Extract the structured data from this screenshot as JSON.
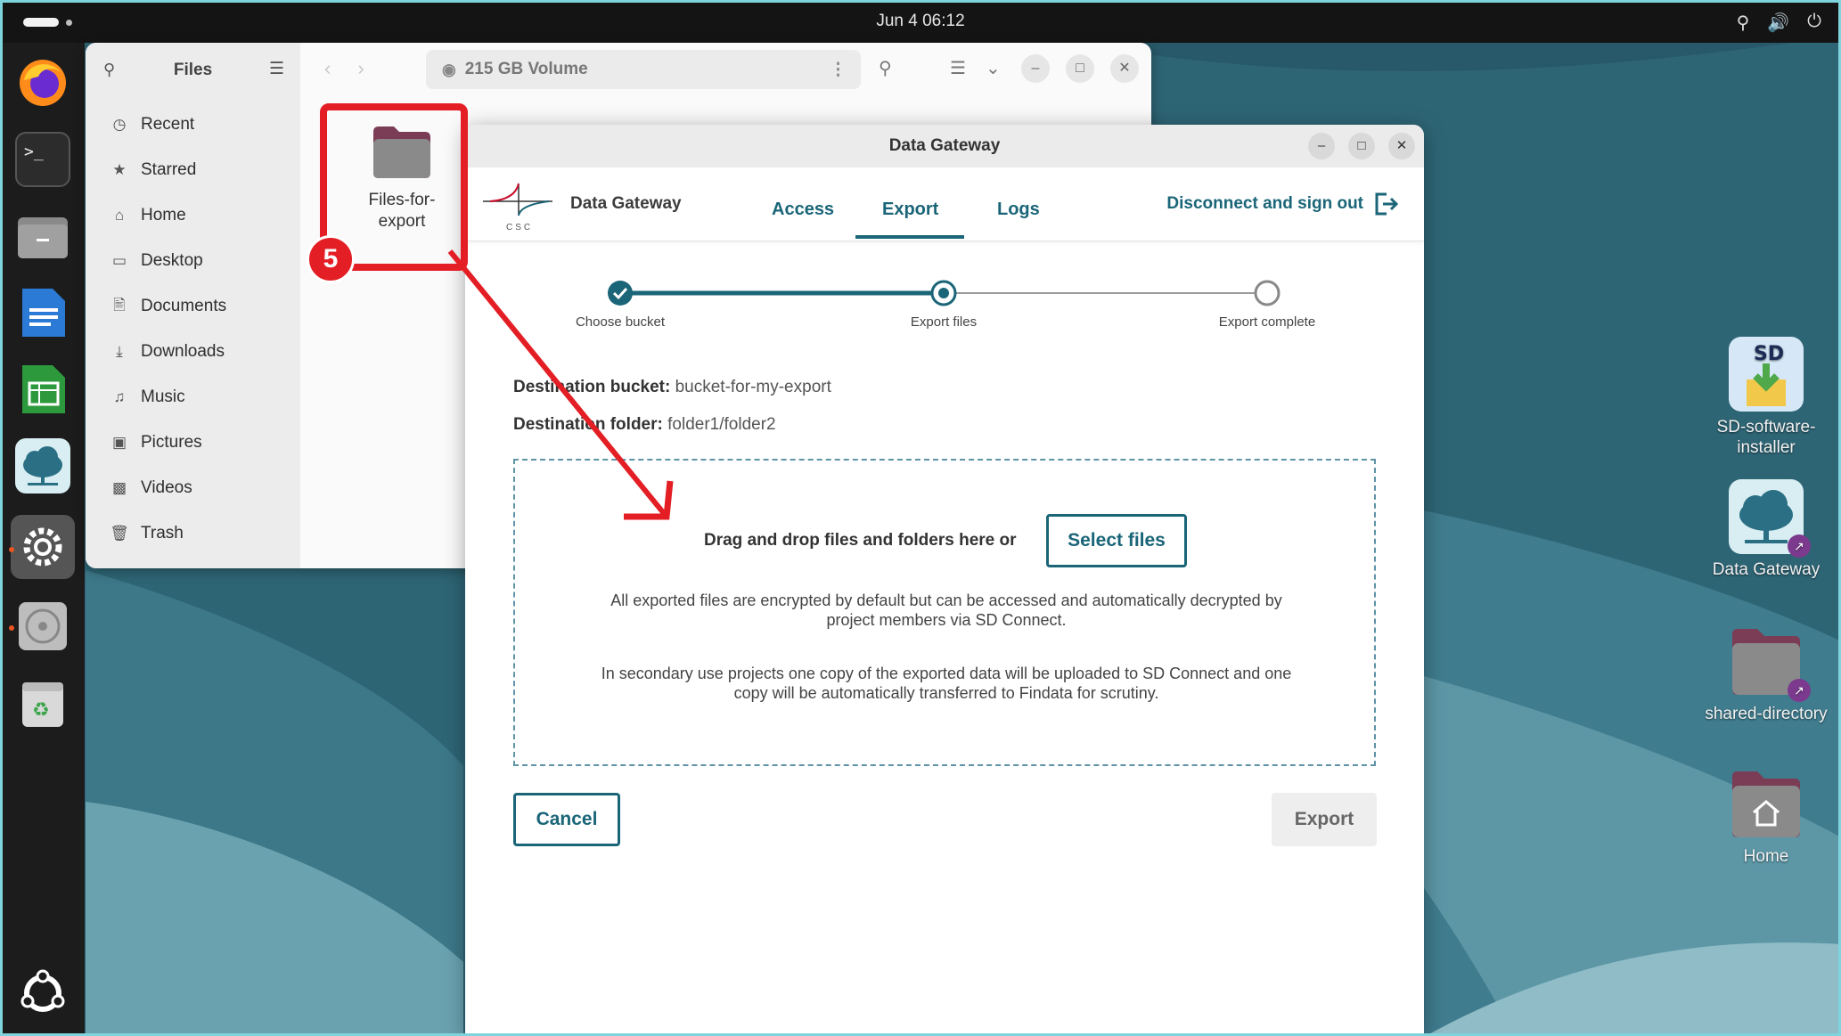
{
  "topbar": {
    "clock": "Jun 4  06:12"
  },
  "dock": {
    "items": [
      "firefox-icon",
      "terminal-icon",
      "files-icon",
      "writer-icon",
      "calc-icon",
      "data-gateway-icon",
      "settings-icon",
      "disc-icon",
      "trash-icon"
    ],
    "show_apps": "show-apps-icon"
  },
  "files": {
    "title": "Files",
    "sidebar": [
      {
        "label": "Recent",
        "icon": "clock-icon"
      },
      {
        "label": "Starred",
        "icon": "star-icon"
      },
      {
        "label": "Home",
        "icon": "home-icon"
      },
      {
        "label": "Desktop",
        "icon": "desktop-icon"
      },
      {
        "label": "Documents",
        "icon": "document-icon"
      },
      {
        "label": "Downloads",
        "icon": "download-icon"
      },
      {
        "label": "Music",
        "icon": "music-icon"
      },
      {
        "label": "Pictures",
        "icon": "picture-icon"
      },
      {
        "label": "Videos",
        "icon": "video-icon"
      },
      {
        "label": "Trash",
        "icon": "trash-icon"
      }
    ],
    "path": "215 GB Volume",
    "folder": {
      "line1": "Files-for-",
      "line2": "export"
    }
  },
  "annotation": {
    "number": "5",
    "color": "#e31e24"
  },
  "dialog": {
    "title": "Data Gateway",
    "brand": "Data Gateway",
    "logo_text": "CSC",
    "tabs": [
      {
        "label": "Access",
        "active": false
      },
      {
        "label": "Export",
        "active": true
      },
      {
        "label": "Logs",
        "active": false
      }
    ],
    "signout": "Disconnect and sign out",
    "steps": [
      {
        "label": "Choose bucket",
        "state": "done"
      },
      {
        "label": "Export files",
        "state": "current"
      },
      {
        "label": "Export complete",
        "state": "todo"
      }
    ],
    "dest_bucket_label": "Destination bucket:",
    "dest_bucket_value": "bucket-for-my-export",
    "dest_folder_label": "Destination folder:",
    "dest_folder_value": "folder1/folder2",
    "drop_text": "Drag and drop files and folders here or",
    "select_files": "Select files",
    "note1_line1": "All exported files are encrypted by default but can be accessed and automatically decrypted by",
    "note1_line2": "project members via SD Connect.",
    "note2_line1": "In secondary use projects one copy of the exported data will be uploaded to SD Connect and one",
    "note2_line2": "copy will be automatically transferred to Findata for scrutiny.",
    "cancel": "Cancel",
    "export": "Export",
    "accent": "#1a6578"
  },
  "desktop_icons": [
    {
      "line1": "SD-software-",
      "line2": "installer",
      "badge_text": "SD"
    },
    {
      "line1": "Data Gateway",
      "line2": ""
    },
    {
      "line1": "shared-directory",
      "line2": ""
    },
    {
      "line1": "Home",
      "line2": ""
    }
  ]
}
